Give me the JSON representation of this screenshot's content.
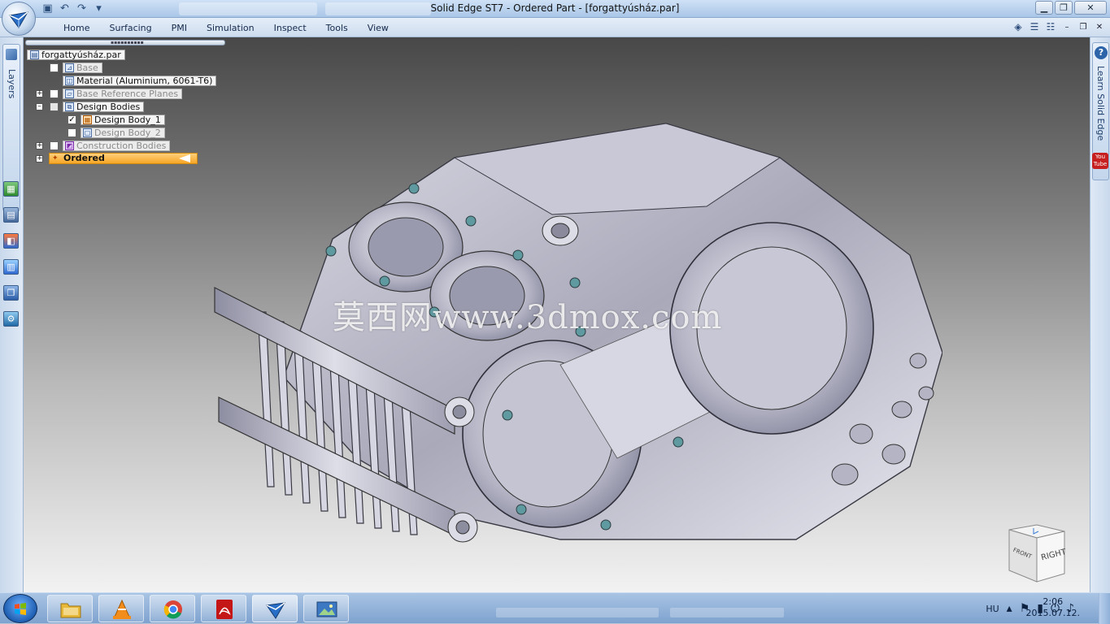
{
  "window": {
    "title": "Solid Edge ST7 - Ordered Part - [forgattyúsház.par]"
  },
  "window_controls": {
    "minimize": "▁",
    "maximize": "❐",
    "close": "✕"
  },
  "qat_icons": [
    "save-icon",
    "undo-icon",
    "redo-icon",
    "customize-icon"
  ],
  "ribbon": {
    "tabs": [
      "Home",
      "Surfacing",
      "PMI",
      "Simulation",
      "Inspect",
      "Tools",
      "View"
    ],
    "right_controls": {
      "minimize": "–",
      "restore": "❐",
      "close": "✕"
    }
  },
  "left_panel": {
    "tab_label": "Layers"
  },
  "right_panel": {
    "tab_label": "Learn Solid Edge",
    "youtube_label": "You Tube"
  },
  "pathfinder": {
    "root": "forgattyúsház.par",
    "items": [
      {
        "label": "Base",
        "dim": true
      },
      {
        "label": "Material (Aluminium, 6061-T6)",
        "dim": false
      },
      {
        "label": "Base Reference Planes",
        "dim": true
      },
      {
        "label": "Design Bodies",
        "dim": false
      },
      {
        "label": "Design Body_1",
        "dim": false
      },
      {
        "label": "Design Body_2",
        "dim": true
      },
      {
        "label": "Construction Bodies",
        "dim": true
      }
    ],
    "ordered": "Ordered"
  },
  "watermark": "莫西网www.3dmox.com",
  "viewcube": {
    "front": "FRONT",
    "right": "RIGHT"
  },
  "taskbar": {
    "apps": [
      "explorer-icon",
      "vlc-icon",
      "chrome-icon",
      "acrobat-icon",
      "solid-edge-icon",
      "photo-viewer-icon"
    ],
    "language": "HU",
    "time": "2:06",
    "date": "2015.07.12."
  }
}
